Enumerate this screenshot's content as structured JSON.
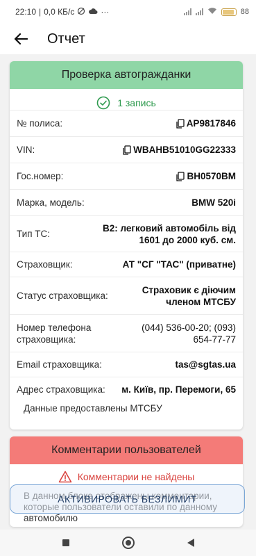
{
  "status": {
    "time": "22:10",
    "network": "0,0 КБ/с",
    "battery": "88"
  },
  "app_bar": {
    "title": "Отчет"
  },
  "insurance": {
    "title": "Проверка автогражданки",
    "count_text": "1 запись",
    "rows": [
      {
        "label": "№ полиса:",
        "value": "AP9817846"
      },
      {
        "label": "VIN:",
        "value": "WBAHB51010GG22333"
      },
      {
        "label": "Гос.номер:",
        "value": "BH0570BM"
      },
      {
        "label": "Марка, модель:",
        "value": "BMW 520i"
      },
      {
        "label": "Тип ТС:",
        "value": "B2: легковий автомобіль від 1601 до 2000 куб. см."
      },
      {
        "label": "Страховщик:",
        "value": "АТ \"СГ \"ТАС\" (приватне)"
      },
      {
        "label": "Статус страховщика:",
        "value": "Страховик є діючим членом МТСБУ"
      },
      {
        "label": "Номер телефона страховщика:",
        "value": "(044) 536-00-20; (093) 654-77-77"
      },
      {
        "label": "Email страховщика:",
        "value": "tas@sgtas.ua"
      },
      {
        "label": "Адрес страховщика:",
        "value": "м. Київ, пр. Перемоги, 65"
      }
    ],
    "source_note": "Данные предоставлены МТСБУ"
  },
  "comments": {
    "title": "Комментарии пользователей",
    "empty_text": "Комментарии не найдены",
    "info_text": "В данном блоке отображены комментарии, которые пользователи оставили по данному автомобилю"
  },
  "cta": {
    "label": "АКТИВИРОВАТЬ БЕЗЛИМИТ"
  },
  "colors": {
    "green_header": "#8fd6a6",
    "red_header": "#f47b78",
    "success": "#2e9a4e",
    "error": "#d9433f"
  }
}
